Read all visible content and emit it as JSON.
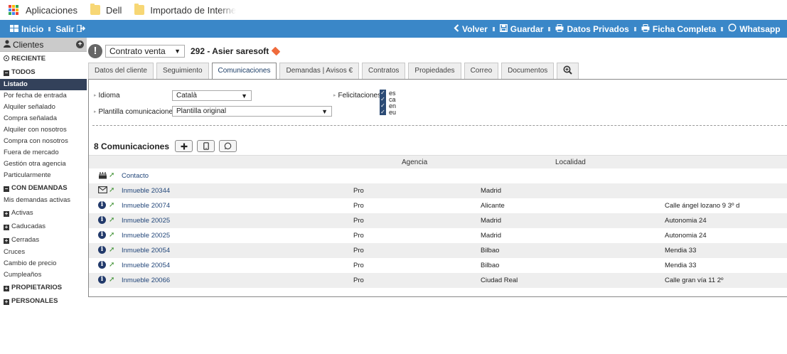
{
  "bookmarks": {
    "items": [
      {
        "label": "Aplicaciones",
        "icon": "apps-grid-icon"
      },
      {
        "label": "Dell",
        "icon": "folder-icon"
      },
      {
        "label": "Importado de Interne",
        "icon": "folder-icon"
      }
    ]
  },
  "topbar": {
    "inicio": "Inicio",
    "salir": "Salir",
    "volver": "Volver",
    "guardar": "Guardar",
    "datos_privados": "Datos Privados",
    "ficha_completa": "Ficha Completa",
    "whatsapp": "Whatsapp"
  },
  "sidebar": {
    "header": "Clientes",
    "items": [
      {
        "label": "RECIENTE",
        "type": "section",
        "marker": "circle"
      },
      {
        "label": "TODOS",
        "type": "section",
        "marker": "minus"
      },
      {
        "label": "Listado",
        "type": "item",
        "active": true
      },
      {
        "label": "Por fecha de entrada",
        "type": "item"
      },
      {
        "label": "Alquiler señalado",
        "type": "item"
      },
      {
        "label": "Compra señalada",
        "type": "item"
      },
      {
        "label": "Alquiler con nosotros",
        "type": "item"
      },
      {
        "label": "Compra con nosotros",
        "type": "item"
      },
      {
        "label": "Fuera de mercado",
        "type": "item"
      },
      {
        "label": "Gestión otra agencia",
        "type": "item"
      },
      {
        "label": "Particularmente",
        "type": "item"
      },
      {
        "label": "CON DEMANDAS",
        "type": "section",
        "marker": "minus"
      },
      {
        "label": "Mis demandas activas",
        "type": "item"
      },
      {
        "label": "Activas",
        "type": "group",
        "marker": "plus"
      },
      {
        "label": "Caducadas",
        "type": "group",
        "marker": "plus"
      },
      {
        "label": "Cerradas",
        "type": "group",
        "marker": "plus"
      },
      {
        "label": "Cruces",
        "type": "item"
      },
      {
        "label": "Cambio de precio",
        "type": "item"
      },
      {
        "label": "Cumpleaños",
        "type": "item"
      },
      {
        "label": "PROPIETARIOS",
        "type": "section",
        "marker": "plus"
      },
      {
        "label": "PERSONALES",
        "type": "section",
        "marker": "plus"
      }
    ]
  },
  "contract": {
    "type_value": "Contrato venta",
    "client_title": "292 - Asier saresoft"
  },
  "tabs": [
    {
      "label": "Datos del cliente"
    },
    {
      "label": "Seguimiento"
    },
    {
      "label": "Comunicaciones",
      "active": true
    },
    {
      "label": "Demandas | Avisos €"
    },
    {
      "label": "Contratos"
    },
    {
      "label": "Propiedades"
    },
    {
      "label": "Correo"
    },
    {
      "label": "Documentos"
    },
    {
      "label": "",
      "icon": "zoom-icon"
    }
  ],
  "form": {
    "idioma_label": "Idioma",
    "idioma_value": "Català",
    "plantilla_label": "Plantilla comunicaciones",
    "plantilla_value": "Plantilla original",
    "felicitaciones_label": "Felicitaciones",
    "felicitaciones": [
      "es",
      "ca",
      "en",
      "eu"
    ]
  },
  "communications": {
    "title": "8 Comunicaciones",
    "columns": {
      "agencia": "Agencia",
      "localidad": "Localidad"
    },
    "rows": [
      {
        "icon": "cake-icon",
        "link": "Contacto",
        "agencia": "",
        "localidad": "",
        "direccion": ""
      },
      {
        "icon": "envelope-icon",
        "link": "Inmueble 20344",
        "agencia": "Pro",
        "localidad": "Madrid",
        "direccion": ""
      },
      {
        "icon": "info-icon",
        "link": "Inmueble 20074",
        "agencia": "Pro",
        "localidad": "Alicante",
        "direccion": "Calle ángel lozano 9 3º d"
      },
      {
        "icon": "info-icon",
        "link": "Inmueble 20025",
        "agencia": "Pro",
        "localidad": "Madrid",
        "direccion": "Autonomia 24"
      },
      {
        "icon": "info-icon",
        "link": "Inmueble 20025",
        "agencia": "Pro",
        "localidad": "Madrid",
        "direccion": "Autonomia 24"
      },
      {
        "icon": "info-icon",
        "link": "Inmueble 20054",
        "agencia": "Pro",
        "localidad": "Bilbao",
        "direccion": "Mendia 33"
      },
      {
        "icon": "info-icon",
        "link": "Inmueble 20054",
        "agencia": "Pro",
        "localidad": "Bilbao",
        "direccion": "Mendia 33"
      },
      {
        "icon": "info-icon",
        "link": "Inmueble 20066",
        "agencia": "Pro",
        "localidad": "Ciudad Real",
        "direccion": "Calle gran vía 11 2º"
      }
    ]
  },
  "colors": {
    "topbar": "#3a87c8",
    "sidebar_active": "#33415a",
    "link": "#23477a"
  }
}
